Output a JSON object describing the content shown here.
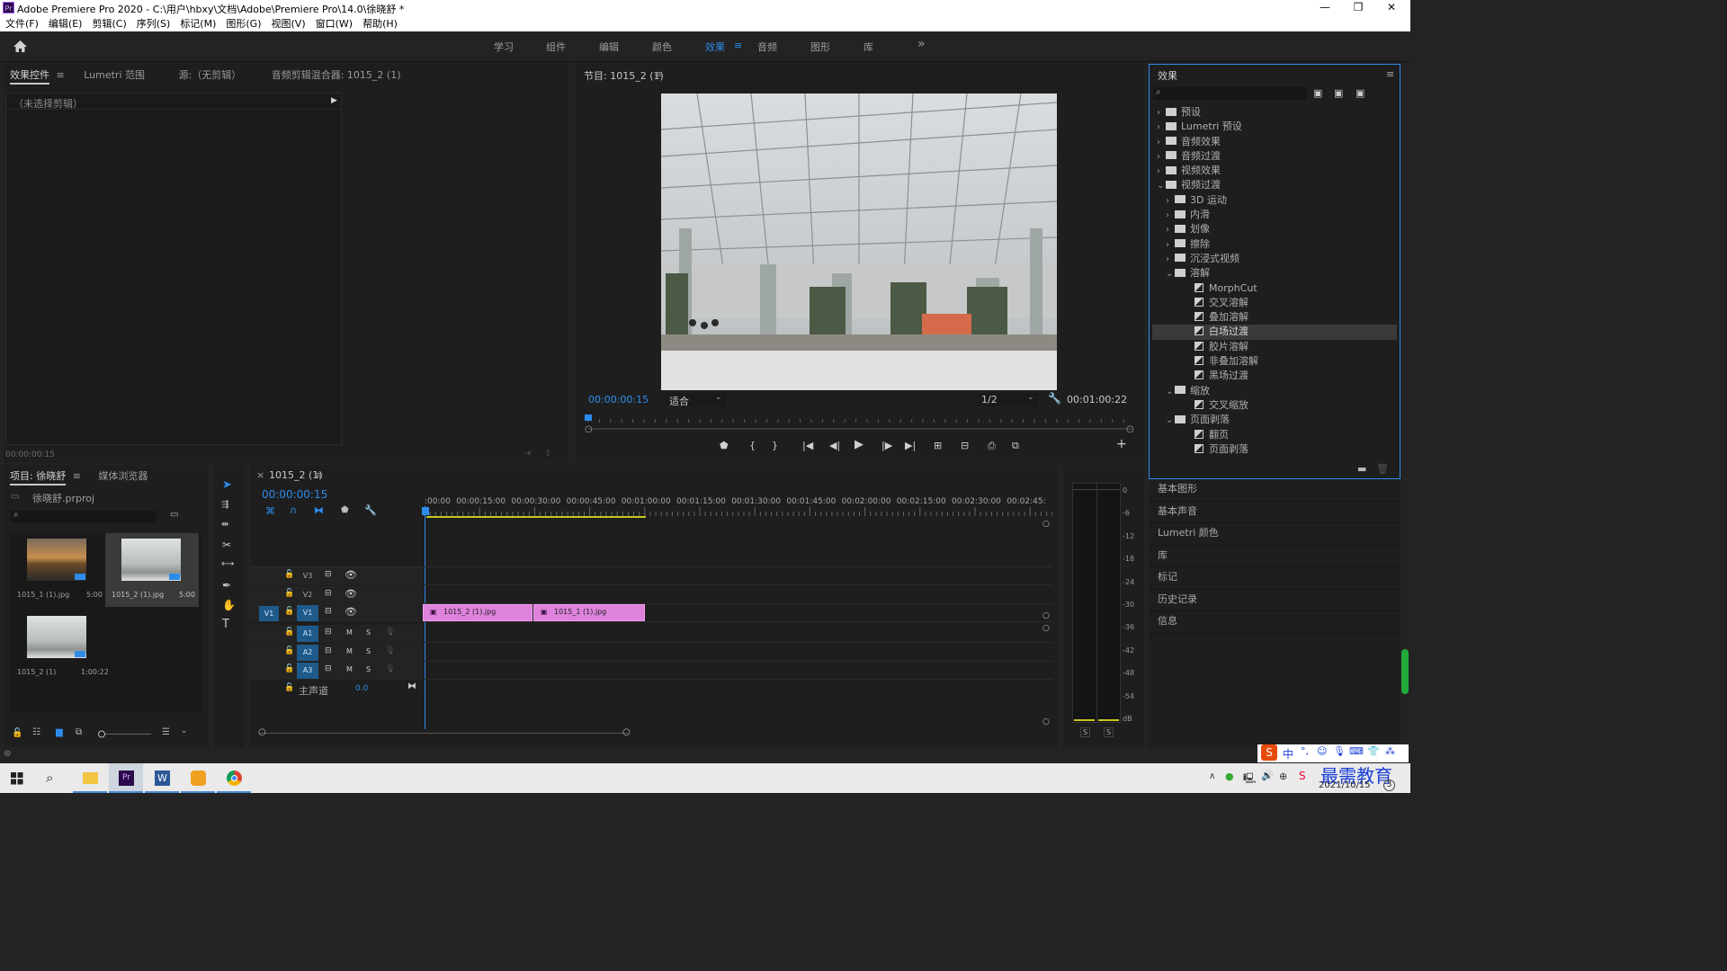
{
  "window": {
    "title": "Adobe Premiere Pro 2020 - C:\\用户\\hbxy\\文档\\Adobe\\Premiere Pro\\14.0\\徐晓舒 *",
    "app_icon": "Pr",
    "minimize": "—",
    "maximize": "❐",
    "close": "✕"
  },
  "menu": [
    "文件(F)",
    "编辑(E)",
    "剪辑(C)",
    "序列(S)",
    "标记(M)",
    "图形(G)",
    "视图(V)",
    "窗口(W)",
    "帮助(H)"
  ],
  "workspaces": {
    "items": [
      "学习",
      "组件",
      "编辑",
      "颜色",
      "效果",
      "音频",
      "图形",
      "库"
    ],
    "active": "效果",
    "menu_icon": "≡",
    "more": "»"
  },
  "source_panel": {
    "tabs": [
      "效果控件",
      "Lumetri 范围",
      "源:（无剪辑）",
      "音频剪辑混合器: 1015_2 (1)"
    ],
    "tab_menu": "≡",
    "no_clip": "（未选择剪辑）",
    "timecode": "00:00:00:15"
  },
  "program": {
    "title": "节目: 1015_2 (1)",
    "menu": "≡",
    "timecode": "00:00:00:15",
    "fit": "适合",
    "quality": "1/2",
    "duration": "00:01:00:22"
  },
  "effects": {
    "title": "效果",
    "menu": "≡",
    "search_placeholder": "",
    "tree": [
      {
        "label": "预设",
        "depth": 0,
        "kind": "folder-star",
        "open": false
      },
      {
        "label": "Lumetri 预设",
        "depth": 0,
        "kind": "folder-star",
        "open": false
      },
      {
        "label": "音频效果",
        "depth": 0,
        "kind": "folder",
        "open": false
      },
      {
        "label": "音频过渡",
        "depth": 0,
        "kind": "folder",
        "open": false
      },
      {
        "label": "视频效果",
        "depth": 0,
        "kind": "folder",
        "open": false
      },
      {
        "label": "视频过渡",
        "depth": 0,
        "kind": "folder",
        "open": true
      },
      {
        "label": "3D 运动",
        "depth": 1,
        "kind": "folder",
        "open": false
      },
      {
        "label": "内滑",
        "depth": 1,
        "kind": "folder",
        "open": false
      },
      {
        "label": "划像",
        "depth": 1,
        "kind": "folder",
        "open": false
      },
      {
        "label": "擦除",
        "depth": 1,
        "kind": "folder",
        "open": false
      },
      {
        "label": "沉浸式视频",
        "depth": 1,
        "kind": "folder",
        "open": false
      },
      {
        "label": "溶解",
        "depth": 1,
        "kind": "folder",
        "open": true
      },
      {
        "label": "MorphCut",
        "depth": 2,
        "kind": "fx"
      },
      {
        "label": "交叉溶解",
        "depth": 2,
        "kind": "fx"
      },
      {
        "label": "叠加溶解",
        "depth": 2,
        "kind": "fx"
      },
      {
        "label": "白场过渡",
        "depth": 2,
        "kind": "fx",
        "selected": true
      },
      {
        "label": "胶片溶解",
        "depth": 2,
        "kind": "fx"
      },
      {
        "label": "非叠加溶解",
        "depth": 2,
        "kind": "fx"
      },
      {
        "label": "黑场过渡",
        "depth": 2,
        "kind": "fx"
      },
      {
        "label": "缩放",
        "depth": 1,
        "kind": "folder",
        "open": true
      },
      {
        "label": "交叉缩放",
        "depth": 2,
        "kind": "fx"
      },
      {
        "label": "页面剥落",
        "depth": 1,
        "kind": "folder",
        "open": true
      },
      {
        "label": "翻页",
        "depth": 2,
        "kind": "fx"
      },
      {
        "label": "页面剥落",
        "depth": 2,
        "kind": "fx"
      }
    ]
  },
  "side_panels": [
    "基本图形",
    "基本声音",
    "Lumetri 颜色",
    "库",
    "标记",
    "历史记录",
    "信息"
  ],
  "project": {
    "tabs": [
      "项目: 徐晓舒",
      "媒体浏览器"
    ],
    "menu": "≡",
    "file": "徐晓舒.prproj",
    "items": [
      {
        "name": "1015_1 (1).jpg",
        "dur": "5:00"
      },
      {
        "name": "1015_2 (1).jpg",
        "dur": "5:00"
      },
      {
        "name": "1015_2 (1)",
        "dur": "1:00:22"
      }
    ]
  },
  "timeline": {
    "seq_close": "×",
    "seq_name": "1015_2 (1)",
    "menu": "≡",
    "timecode": "00:00:00:15",
    "ruler": [
      ":00:00",
      "00:00:15:00",
      "00:00:30:00",
      "00:00:45:00",
      "00:01:00:00",
      "00:01:15:00",
      "00:01:30:00",
      "00:01:45:00",
      "00:02:00:00",
      "00:02:15:00",
      "00:02:30:00",
      "00:02:45:"
    ],
    "video_tracks": [
      "V3",
      "V2",
      "V1"
    ],
    "audio_tracks": [
      "A1",
      "A2",
      "A3"
    ],
    "source_patch": "V1",
    "m": "M",
    "s": "S",
    "master": "主声道",
    "master_val": "0.0",
    "clips": [
      {
        "name": "1015_2 (1).jpg",
        "start": 0,
        "end": 30
      },
      {
        "name": "1015_1 (1).jpg",
        "start": 30,
        "end": 60
      }
    ]
  },
  "meter": {
    "labels": [
      "0",
      "-6",
      "-12",
      "-18",
      "-24",
      "-30",
      "-36",
      "-42",
      "-48",
      "-54",
      "dB"
    ],
    "solo": [
      "S",
      "S"
    ]
  },
  "taskbar": {
    "time": "2021/10/15",
    "ime": "中",
    "watermark": "最需教育",
    "badge": "3"
  }
}
